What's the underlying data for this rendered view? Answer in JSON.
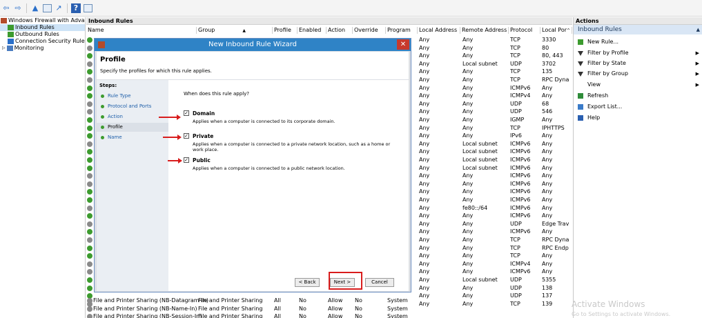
{
  "toolbar": {
    "back_icon": "back-arrow-icon",
    "forward_icon": "forward-arrow-icon",
    "up_icon": "up-folder-icon",
    "show_hide_icon": "show-hide-tree-icon",
    "export_icon": "export-icon",
    "help_icon": "help-icon"
  },
  "tree": {
    "items": [
      {
        "label": "Windows Firewall with Advanced",
        "icon": "firewall-icon"
      },
      {
        "label": "Inbound Rules",
        "icon": "inbound-rules-icon"
      },
      {
        "label": "Outbound Rules",
        "icon": "outbound-rules-icon"
      },
      {
        "label": "Connection Security Rules",
        "icon": "connection-security-icon"
      },
      {
        "label": "Monitoring",
        "icon": "monitoring-icon"
      }
    ]
  },
  "main": {
    "panel_title": "Inbound Rules",
    "columns": [
      "Name",
      "Group",
      "Profile",
      "Enabled",
      "Action",
      "Override",
      "Program",
      "Local Address",
      "Remote Address",
      "Protocol",
      "Local Por"
    ],
    "right_rows": [
      {
        "local": "Any",
        "remote": "Any",
        "protocol": "TCP",
        "port": "3330"
      },
      {
        "local": "Any",
        "remote": "Any",
        "protocol": "TCP",
        "port": "80"
      },
      {
        "local": "Any",
        "remote": "Any",
        "protocol": "TCP",
        "port": "80, 443"
      },
      {
        "local": "Any",
        "remote": "Local subnet",
        "protocol": "UDP",
        "port": "3702"
      },
      {
        "local": "Any",
        "remote": "Any",
        "protocol": "TCP",
        "port": "135"
      },
      {
        "local": "Any",
        "remote": "Any",
        "protocol": "TCP",
        "port": "RPC Dyna"
      },
      {
        "local": "Any",
        "remote": "Any",
        "protocol": "ICMPv6",
        "port": "Any"
      },
      {
        "local": "Any",
        "remote": "Any",
        "protocol": "ICMPv4",
        "port": "Any"
      },
      {
        "local": "Any",
        "remote": "Any",
        "protocol": "UDP",
        "port": "68"
      },
      {
        "local": "Any",
        "remote": "Any",
        "protocol": "UDP",
        "port": "546"
      },
      {
        "local": "Any",
        "remote": "Any",
        "protocol": "IGMP",
        "port": "Any"
      },
      {
        "local": "Any",
        "remote": "Any",
        "protocol": "TCP",
        "port": "IPHTTPS"
      },
      {
        "local": "Any",
        "remote": "Any",
        "protocol": "IPv6",
        "port": "Any"
      },
      {
        "local": "Any",
        "remote": "Local subnet",
        "protocol": "ICMPv6",
        "port": "Any"
      },
      {
        "local": "Any",
        "remote": "Local subnet",
        "protocol": "ICMPv6",
        "port": "Any"
      },
      {
        "local": "Any",
        "remote": "Local subnet",
        "protocol": "ICMPv6",
        "port": "Any"
      },
      {
        "local": "Any",
        "remote": "Local subnet",
        "protocol": "ICMPv6",
        "port": "Any"
      },
      {
        "local": "Any",
        "remote": "Any",
        "protocol": "ICMPv6",
        "port": "Any"
      },
      {
        "local": "Any",
        "remote": "Any",
        "protocol": "ICMPv6",
        "port": "Any"
      },
      {
        "local": "Any",
        "remote": "Any",
        "protocol": "ICMPv6",
        "port": "Any"
      },
      {
        "local": "Any",
        "remote": "Any",
        "protocol": "ICMPv6",
        "port": "Any"
      },
      {
        "local": "Any",
        "remote": "fe80::/64",
        "protocol": "ICMPv6",
        "port": "Any"
      },
      {
        "local": "Any",
        "remote": "Any",
        "protocol": "ICMPv6",
        "port": "Any"
      },
      {
        "local": "Any",
        "remote": "Any",
        "protocol": "UDP",
        "port": "Edge Trav"
      },
      {
        "local": "Any",
        "remote": "Any",
        "protocol": "ICMPv6",
        "port": "Any"
      },
      {
        "local": "Any",
        "remote": "Any",
        "protocol": "TCP",
        "port": "RPC Dyna"
      },
      {
        "local": "Any",
        "remote": "Any",
        "protocol": "TCP",
        "port": "RPC Endp"
      },
      {
        "local": "Any",
        "remote": "Any",
        "protocol": "TCP",
        "port": "Any"
      },
      {
        "local": "Any",
        "remote": "Any",
        "protocol": "ICMPv4",
        "port": "Any"
      },
      {
        "local": "Any",
        "remote": "Any",
        "protocol": "ICMPv6",
        "port": "Any"
      },
      {
        "local": "Any",
        "remote": "Local subnet",
        "protocol": "UDP",
        "port": "5355"
      },
      {
        "local": "Any",
        "remote": "Any",
        "protocol": "UDP",
        "port": "138"
      },
      {
        "local": "Any",
        "remote": "Any",
        "protocol": "UDP",
        "port": "137"
      },
      {
        "local": "Any",
        "remote": "Any",
        "protocol": "TCP",
        "port": "139"
      }
    ],
    "bottom_rows": [
      {
        "name": "File and Printer Sharing (NB-Datagram-In)",
        "group": "File and Printer Sharing",
        "profile": "All",
        "enabled": "No",
        "action": "Allow",
        "override": "No",
        "program": "System"
      },
      {
        "name": "File and Printer Sharing (NB-Name-In)",
        "group": "File and Printer Sharing",
        "profile": "All",
        "enabled": "No",
        "action": "Allow",
        "override": "No",
        "program": "System"
      },
      {
        "name": "File and Printer Sharing (NB-Session-In)",
        "group": "File and Printer Sharing",
        "profile": "All",
        "enabled": "No",
        "action": "Allow",
        "override": "No",
        "program": "System"
      }
    ]
  },
  "actions": {
    "title": "Actions",
    "subheader": "Inbound Rules",
    "items": [
      {
        "label": "New Rule...",
        "icon": "new-rule-icon",
        "submenu": false
      },
      {
        "label": "Filter by Profile",
        "icon": "filter-icon",
        "submenu": true
      },
      {
        "label": "Filter by State",
        "icon": "filter-icon",
        "submenu": true
      },
      {
        "label": "Filter by Group",
        "icon": "filter-icon",
        "submenu": true
      },
      {
        "label": "View",
        "icon": "",
        "submenu": true
      },
      {
        "label": "Refresh",
        "icon": "refresh-icon",
        "submenu": false
      },
      {
        "label": "Export List...",
        "icon": "export-list-icon",
        "submenu": false
      },
      {
        "label": "Help",
        "icon": "help-icon",
        "submenu": false
      }
    ]
  },
  "wizard": {
    "title": "New Inbound Rule Wizard",
    "heading": "Profile",
    "subheading": "Specify the profiles for which this rule applies.",
    "steps_label": "Steps:",
    "steps": [
      "Rule Type",
      "Protocol and Ports",
      "Action",
      "Profile",
      "Name"
    ],
    "current_step": "Profile",
    "question": "When does this rule apply?",
    "options": [
      {
        "label": "Domain",
        "checked": true,
        "desc": "Applies when a computer is connected to its corporate domain."
      },
      {
        "label": "Private",
        "checked": true,
        "desc": "Applies when a computer is connected to a private network location, such as a home or work place."
      },
      {
        "label": "Public",
        "checked": true,
        "desc": "Applies when a computer is connected to a public network location."
      }
    ],
    "back_label": "< Back",
    "next_label": "Next >",
    "cancel_label": "Cancel",
    "close_glyph": "✕",
    "check_glyph": "✓"
  },
  "watermark": {
    "line1": "Activate Windows",
    "line2": "Go to Settings to activate Windows."
  },
  "colors": {
    "title_bar": "#2f83c6",
    "highlight_red": "#d81c1c",
    "enabled_green": "#3d9b2f"
  }
}
